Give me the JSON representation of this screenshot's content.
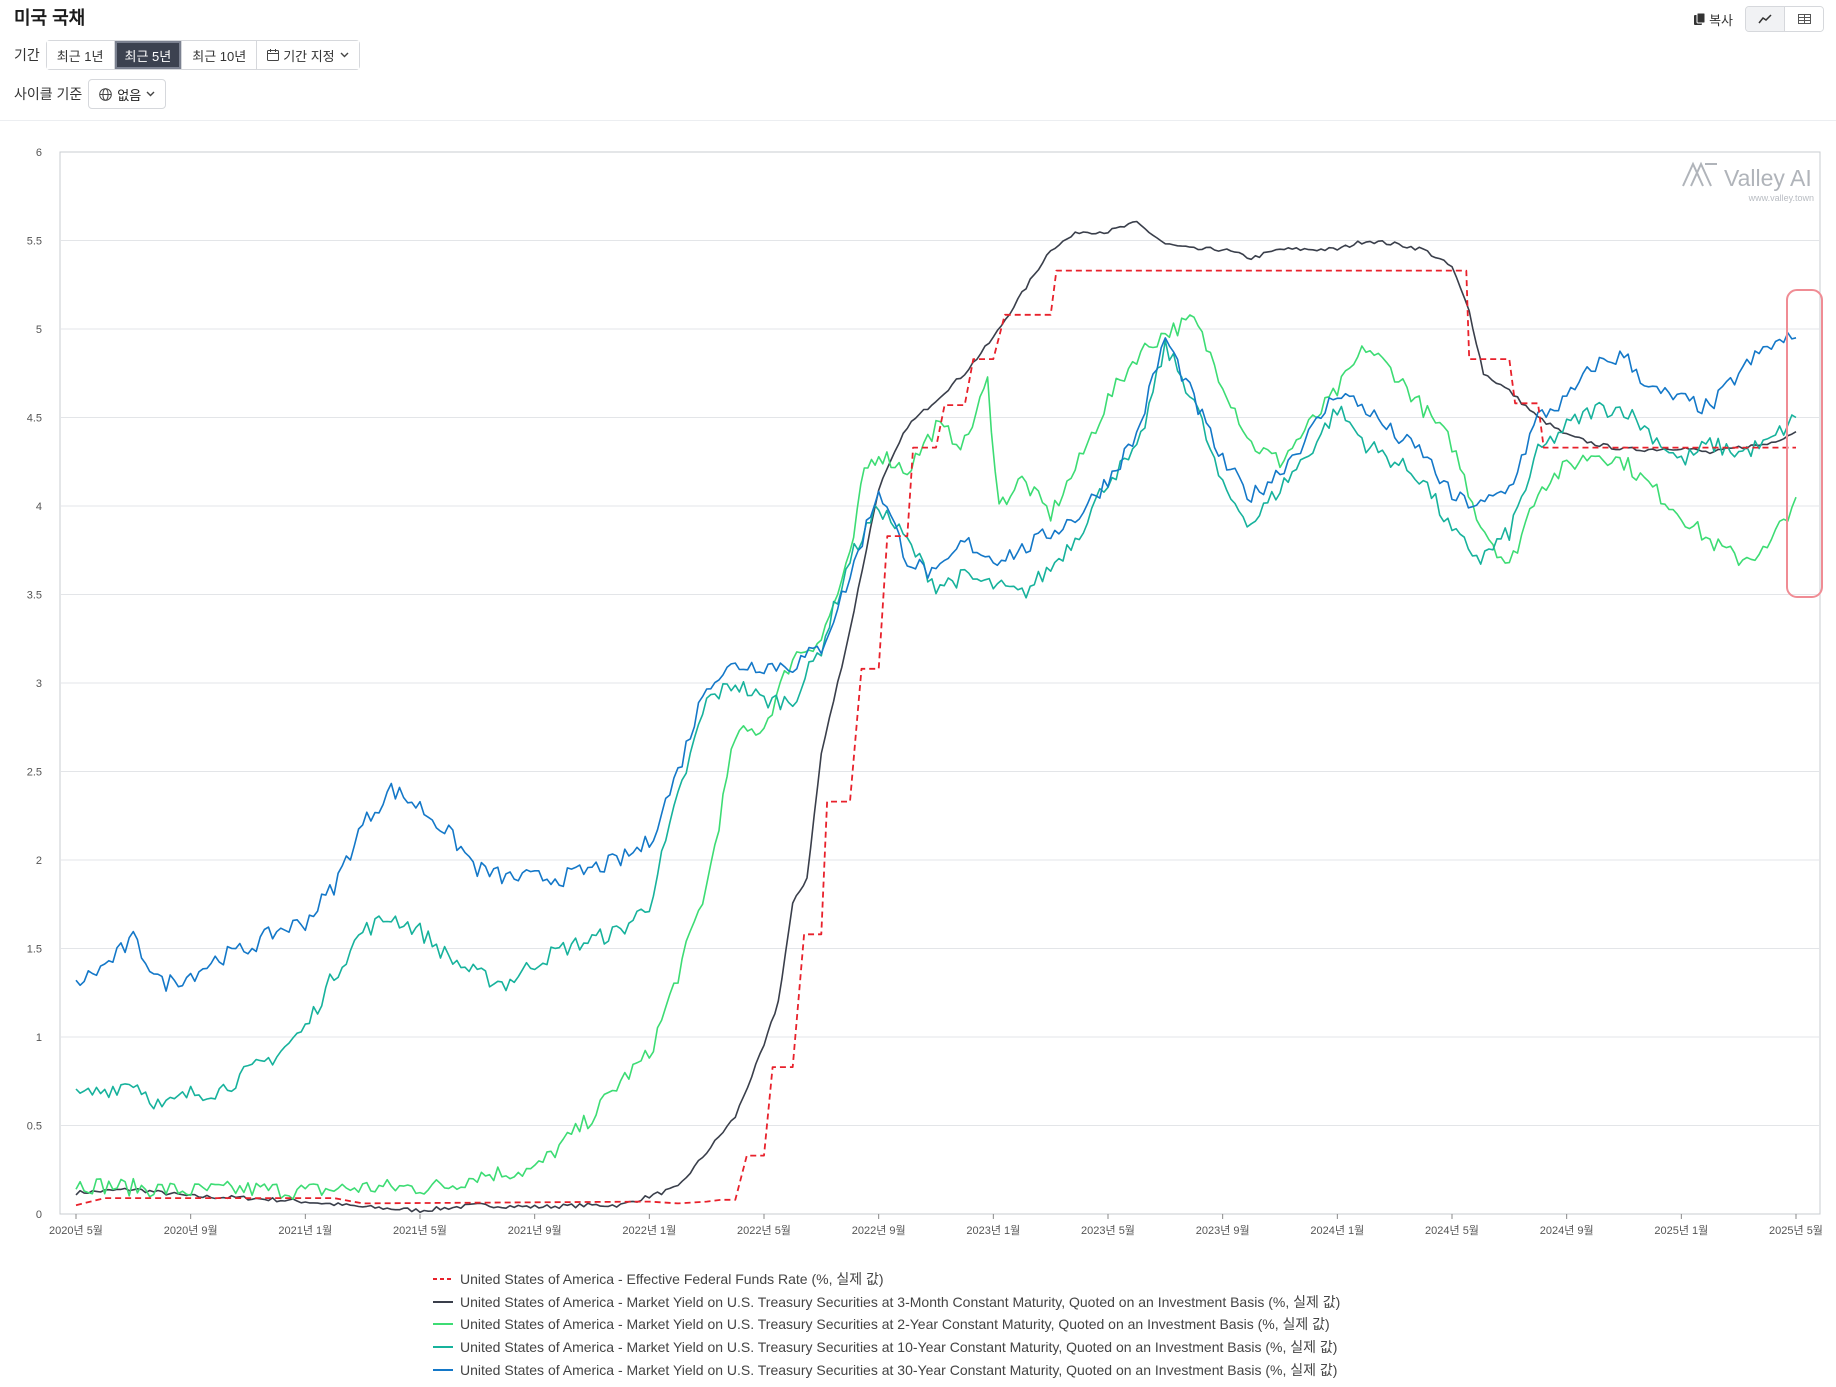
{
  "page_title": "미국 국채",
  "actions": {
    "copy_label": "복사",
    "chart_view_icon": "line-chart-icon",
    "table_view_icon": "table-icon"
  },
  "filters": {
    "period_label": "기간",
    "period_options": [
      "최근 1년",
      "최근 5년",
      "최근 10년"
    ],
    "selected_period": "최근 5년",
    "custom_period_label": "기간 지정",
    "cycle_label": "사이클 기준",
    "cycle_value": "없음"
  },
  "watermark": {
    "brand": "Valley AI",
    "url": "www.valley.town"
  },
  "colors": {
    "ffr": "#e8212b",
    "t3m": "#3a3f4b",
    "t2y": "#3ddc74",
    "t10y": "#17b29c",
    "t30y": "#1478c8",
    "highlight": "#f08c94"
  },
  "chart_data": {
    "type": "line",
    "ylim": [
      0,
      6
    ],
    "y_ticks": [
      "0",
      "0.5",
      "1",
      "1.5",
      "2",
      "2.5",
      "3",
      "3.5",
      "4",
      "4.5",
      "5",
      "5.5",
      "6"
    ],
    "x_ticks": [
      "2020년 5월",
      "2020년 9월",
      "2021년 1월",
      "2021년 5월",
      "2021년 9월",
      "2022년 1월",
      "2022년 5월",
      "2022년 9월",
      "2023년 1월",
      "2023년 5월",
      "2023년 9월",
      "2024년 1월",
      "2024년 5월",
      "2024년 9월",
      "2025년 1월",
      "2025년 5월"
    ],
    "grid": true,
    "legend_position": "bottom",
    "series": [
      {
        "name": "United States of America - Effective Federal Funds Rate (%, 실제 값)",
        "key": "ffr",
        "style": "dashed-step",
        "points": [
          [
            0,
            0.05
          ],
          [
            1,
            0.09
          ],
          [
            9,
            0.09
          ],
          [
            10,
            0.06
          ],
          [
            20,
            0.07
          ],
          [
            21,
            0.06
          ],
          [
            22,
            0.07
          ],
          [
            22.5,
            0.08
          ],
          [
            23,
            0.08
          ],
          [
            23.4,
            0.33
          ],
          [
            24,
            0.33
          ],
          [
            24.3,
            0.83
          ],
          [
            25,
            0.83
          ],
          [
            25.4,
            1.58
          ],
          [
            26,
            1.58
          ],
          [
            26.2,
            2.33
          ],
          [
            27,
            2.33
          ],
          [
            27.4,
            3.08
          ],
          [
            28,
            3.08
          ],
          [
            28.3,
            3.83
          ],
          [
            29,
            3.83
          ],
          [
            29.2,
            4.33
          ],
          [
            30,
            4.33
          ],
          [
            30.3,
            4.57
          ],
          [
            31,
            4.57
          ],
          [
            31.3,
            4.83
          ],
          [
            32,
            4.83
          ],
          [
            32.4,
            5.08
          ],
          [
            34,
            5.08
          ],
          [
            34.2,
            5.33
          ],
          [
            48.5,
            5.33
          ],
          [
            48.6,
            4.83
          ],
          [
            50,
            4.83
          ],
          [
            50.2,
            4.58
          ],
          [
            51,
            4.58
          ],
          [
            51.2,
            4.33
          ],
          [
            60,
            4.33
          ]
        ]
      },
      {
        "name": "United States of America - Market Yield on U.S. Treasury Securities at 3-Month Constant Maturity, Quoted on an Investment Basis (%, 실제 값)",
        "key": "t3m",
        "style": "solid",
        "points": [
          [
            0,
            0.12
          ],
          [
            2,
            0.14
          ],
          [
            4,
            0.1
          ],
          [
            6,
            0.09
          ],
          [
            8,
            0.07
          ],
          [
            10,
            0.04
          ],
          [
            12,
            0.02
          ],
          [
            14,
            0.05
          ],
          [
            16,
            0.04
          ],
          [
            18,
            0.05
          ],
          [
            19,
            0.05
          ],
          [
            20,
            0.1
          ],
          [
            21,
            0.15
          ],
          [
            22,
            0.35
          ],
          [
            23,
            0.55
          ],
          [
            24,
            0.95
          ],
          [
            24.5,
            1.2
          ],
          [
            25,
            1.75
          ],
          [
            25.5,
            1.9
          ],
          [
            26,
            2.6
          ],
          [
            27,
            3.3
          ],
          [
            28,
            4.1
          ],
          [
            29,
            4.45
          ],
          [
            30,
            4.6
          ],
          [
            31,
            4.75
          ],
          [
            32,
            4.95
          ],
          [
            33,
            5.2
          ],
          [
            34,
            5.45
          ],
          [
            35,
            5.55
          ],
          [
            36,
            5.55
          ],
          [
            37,
            5.6
          ],
          [
            38,
            5.48
          ],
          [
            39,
            5.45
          ],
          [
            40,
            5.45
          ],
          [
            41,
            5.4
          ],
          [
            42,
            5.45
          ],
          [
            43,
            5.45
          ],
          [
            44,
            5.45
          ],
          [
            45,
            5.5
          ],
          [
            46,
            5.48
          ],
          [
            47,
            5.45
          ],
          [
            48,
            5.35
          ],
          [
            48.6,
            5.1
          ],
          [
            49.1,
            4.75
          ],
          [
            50,
            4.65
          ],
          [
            51,
            4.5
          ],
          [
            52,
            4.4
          ],
          [
            53,
            4.35
          ],
          [
            54,
            4.32
          ],
          [
            55,
            4.32
          ],
          [
            56,
            4.33
          ],
          [
            57,
            4.3
          ],
          [
            58,
            4.33
          ],
          [
            59,
            4.35
          ],
          [
            60,
            4.42
          ]
        ]
      },
      {
        "name": "United States of America - Market Yield on U.S. Treasury Securities at 2-Year Constant Maturity, Quoted on an Investment Basis (%, 실제 값)",
        "key": "t2y",
        "style": "solid",
        "points": [
          [
            0,
            0.17
          ],
          [
            2,
            0.15
          ],
          [
            4,
            0.13
          ],
          [
            6,
            0.14
          ],
          [
            8,
            0.13
          ],
          [
            10,
            0.15
          ],
          [
            12,
            0.15
          ],
          [
            13,
            0.16
          ],
          [
            14,
            0.22
          ],
          [
            16,
            0.25
          ],
          [
            17,
            0.4
          ],
          [
            18,
            0.55
          ],
          [
            19,
            0.75
          ],
          [
            20,
            0.9
          ],
          [
            21,
            1.35
          ],
          [
            22,
            1.85
          ],
          [
            23,
            2.7
          ],
          [
            24,
            2.75
          ],
          [
            25,
            3.15
          ],
          [
            26,
            3.25
          ],
          [
            27,
            3.7
          ],
          [
            27.5,
            4.2
          ],
          [
            28,
            4.3
          ],
          [
            29,
            4.2
          ],
          [
            30,
            4.45
          ],
          [
            31,
            4.35
          ],
          [
            31.8,
            4.7
          ],
          [
            32.2,
            4.0
          ],
          [
            33,
            4.15
          ],
          [
            34,
            3.95
          ],
          [
            35,
            4.25
          ],
          [
            36,
            4.6
          ],
          [
            37,
            4.85
          ],
          [
            38,
            4.98
          ],
          [
            39,
            5.05
          ],
          [
            40,
            4.7
          ],
          [
            41,
            4.35
          ],
          [
            42,
            4.25
          ],
          [
            43,
            4.45
          ],
          [
            44,
            4.65
          ],
          [
            45,
            4.9
          ],
          [
            46,
            4.75
          ],
          [
            47,
            4.55
          ],
          [
            48,
            4.35
          ],
          [
            49,
            3.9
          ],
          [
            50,
            3.65
          ],
          [
            51,
            4.1
          ],
          [
            52,
            4.22
          ],
          [
            53,
            4.3
          ],
          [
            54,
            4.25
          ],
          [
            55,
            4.1
          ],
          [
            56,
            3.95
          ],
          [
            57,
            3.8
          ],
          [
            58,
            3.7
          ],
          [
            59,
            3.75
          ],
          [
            60,
            4.05
          ]
        ]
      },
      {
        "name": "United States of America - Market Yield on U.S. Treasury Securities at 10-Year Constant Maturity, Quoted on an Investment Basis (%, 실제 값)",
        "key": "t10y",
        "style": "solid",
        "points": [
          [
            0,
            0.66
          ],
          [
            1,
            0.7
          ],
          [
            2,
            0.75
          ],
          [
            3,
            0.6
          ],
          [
            4,
            0.68
          ],
          [
            5,
            0.7
          ],
          [
            6,
            0.8
          ],
          [
            7,
            0.9
          ],
          [
            8,
            1.05
          ],
          [
            9,
            1.35
          ],
          [
            10,
            1.6
          ],
          [
            11,
            1.68
          ],
          [
            12,
            1.6
          ],
          [
            13,
            1.45
          ],
          [
            14,
            1.35
          ],
          [
            15,
            1.3
          ],
          [
            16,
            1.42
          ],
          [
            17,
            1.5
          ],
          [
            18,
            1.55
          ],
          [
            19,
            1.6
          ],
          [
            20,
            1.75
          ],
          [
            21,
            2.35
          ],
          [
            22,
            2.9
          ],
          [
            23,
            3.0
          ],
          [
            24,
            2.9
          ],
          [
            25,
            2.9
          ],
          [
            26,
            3.2
          ],
          [
            27,
            3.7
          ],
          [
            28,
            4.0
          ],
          [
            29,
            3.8
          ],
          [
            30,
            3.55
          ],
          [
            31,
            3.6
          ],
          [
            32,
            3.55
          ],
          [
            33,
            3.5
          ],
          [
            34,
            3.65
          ],
          [
            35,
            3.85
          ],
          [
            36,
            4.15
          ],
          [
            37,
            4.3
          ],
          [
            38,
            4.9
          ],
          [
            39,
            4.6
          ],
          [
            40,
            4.1
          ],
          [
            41,
            3.9
          ],
          [
            42,
            4.1
          ],
          [
            43,
            4.3
          ],
          [
            44,
            4.55
          ],
          [
            45,
            4.35
          ],
          [
            46,
            4.25
          ],
          [
            47,
            4.15
          ],
          [
            48,
            3.85
          ],
          [
            49,
            3.7
          ],
          [
            50,
            3.85
          ],
          [
            51,
            4.3
          ],
          [
            52,
            4.45
          ],
          [
            53,
            4.55
          ],
          [
            54,
            4.55
          ],
          [
            55,
            4.4
          ],
          [
            56,
            4.25
          ],
          [
            57,
            4.35
          ],
          [
            58,
            4.3
          ],
          [
            59,
            4.35
          ],
          [
            60,
            4.5
          ]
        ]
      },
      {
        "name": "United States of America - Market Yield on U.S. Treasury Securities at 30-Year Constant Maturity, Quoted on an Investment Basis (%, 실제 값)",
        "key": "t30y",
        "style": "solid",
        "points": [
          [
            0,
            1.3
          ],
          [
            1,
            1.4
          ],
          [
            2,
            1.55
          ],
          [
            3,
            1.3
          ],
          [
            4,
            1.35
          ],
          [
            5,
            1.45
          ],
          [
            6,
            1.5
          ],
          [
            7,
            1.6
          ],
          [
            8,
            1.65
          ],
          [
            9,
            1.85
          ],
          [
            10,
            2.2
          ],
          [
            11,
            2.4
          ],
          [
            12,
            2.3
          ],
          [
            13,
            2.15
          ],
          [
            14,
            1.95
          ],
          [
            15,
            1.9
          ],
          [
            16,
            1.9
          ],
          [
            17,
            1.9
          ],
          [
            18,
            1.95
          ],
          [
            19,
            2.0
          ],
          [
            20,
            2.1
          ],
          [
            21,
            2.5
          ],
          [
            22,
            3.0
          ],
          [
            23,
            3.1
          ],
          [
            24,
            3.1
          ],
          [
            25,
            3.1
          ],
          [
            26,
            3.2
          ],
          [
            27,
            3.6
          ],
          [
            28,
            4.1
          ],
          [
            29,
            3.7
          ],
          [
            30,
            3.6
          ],
          [
            31,
            3.8
          ],
          [
            32,
            3.7
          ],
          [
            33,
            3.75
          ],
          [
            34,
            3.85
          ],
          [
            35,
            3.95
          ],
          [
            36,
            4.15
          ],
          [
            37,
            4.4
          ],
          [
            38,
            4.95
          ],
          [
            39,
            4.6
          ],
          [
            40,
            4.25
          ],
          [
            41,
            4.05
          ],
          [
            42,
            4.2
          ],
          [
            43,
            4.4
          ],
          [
            44,
            4.65
          ],
          [
            45,
            4.55
          ],
          [
            46,
            4.4
          ],
          [
            47,
            4.3
          ],
          [
            48,
            4.05
          ],
          [
            49,
            4.0
          ],
          [
            50,
            4.1
          ],
          [
            51,
            4.5
          ],
          [
            52,
            4.6
          ],
          [
            53,
            4.8
          ],
          [
            54,
            4.85
          ],
          [
            55,
            4.65
          ],
          [
            56,
            4.6
          ],
          [
            57,
            4.55
          ],
          [
            58,
            4.75
          ],
          [
            59,
            4.9
          ],
          [
            60,
            4.95
          ]
        ]
      }
    ]
  }
}
